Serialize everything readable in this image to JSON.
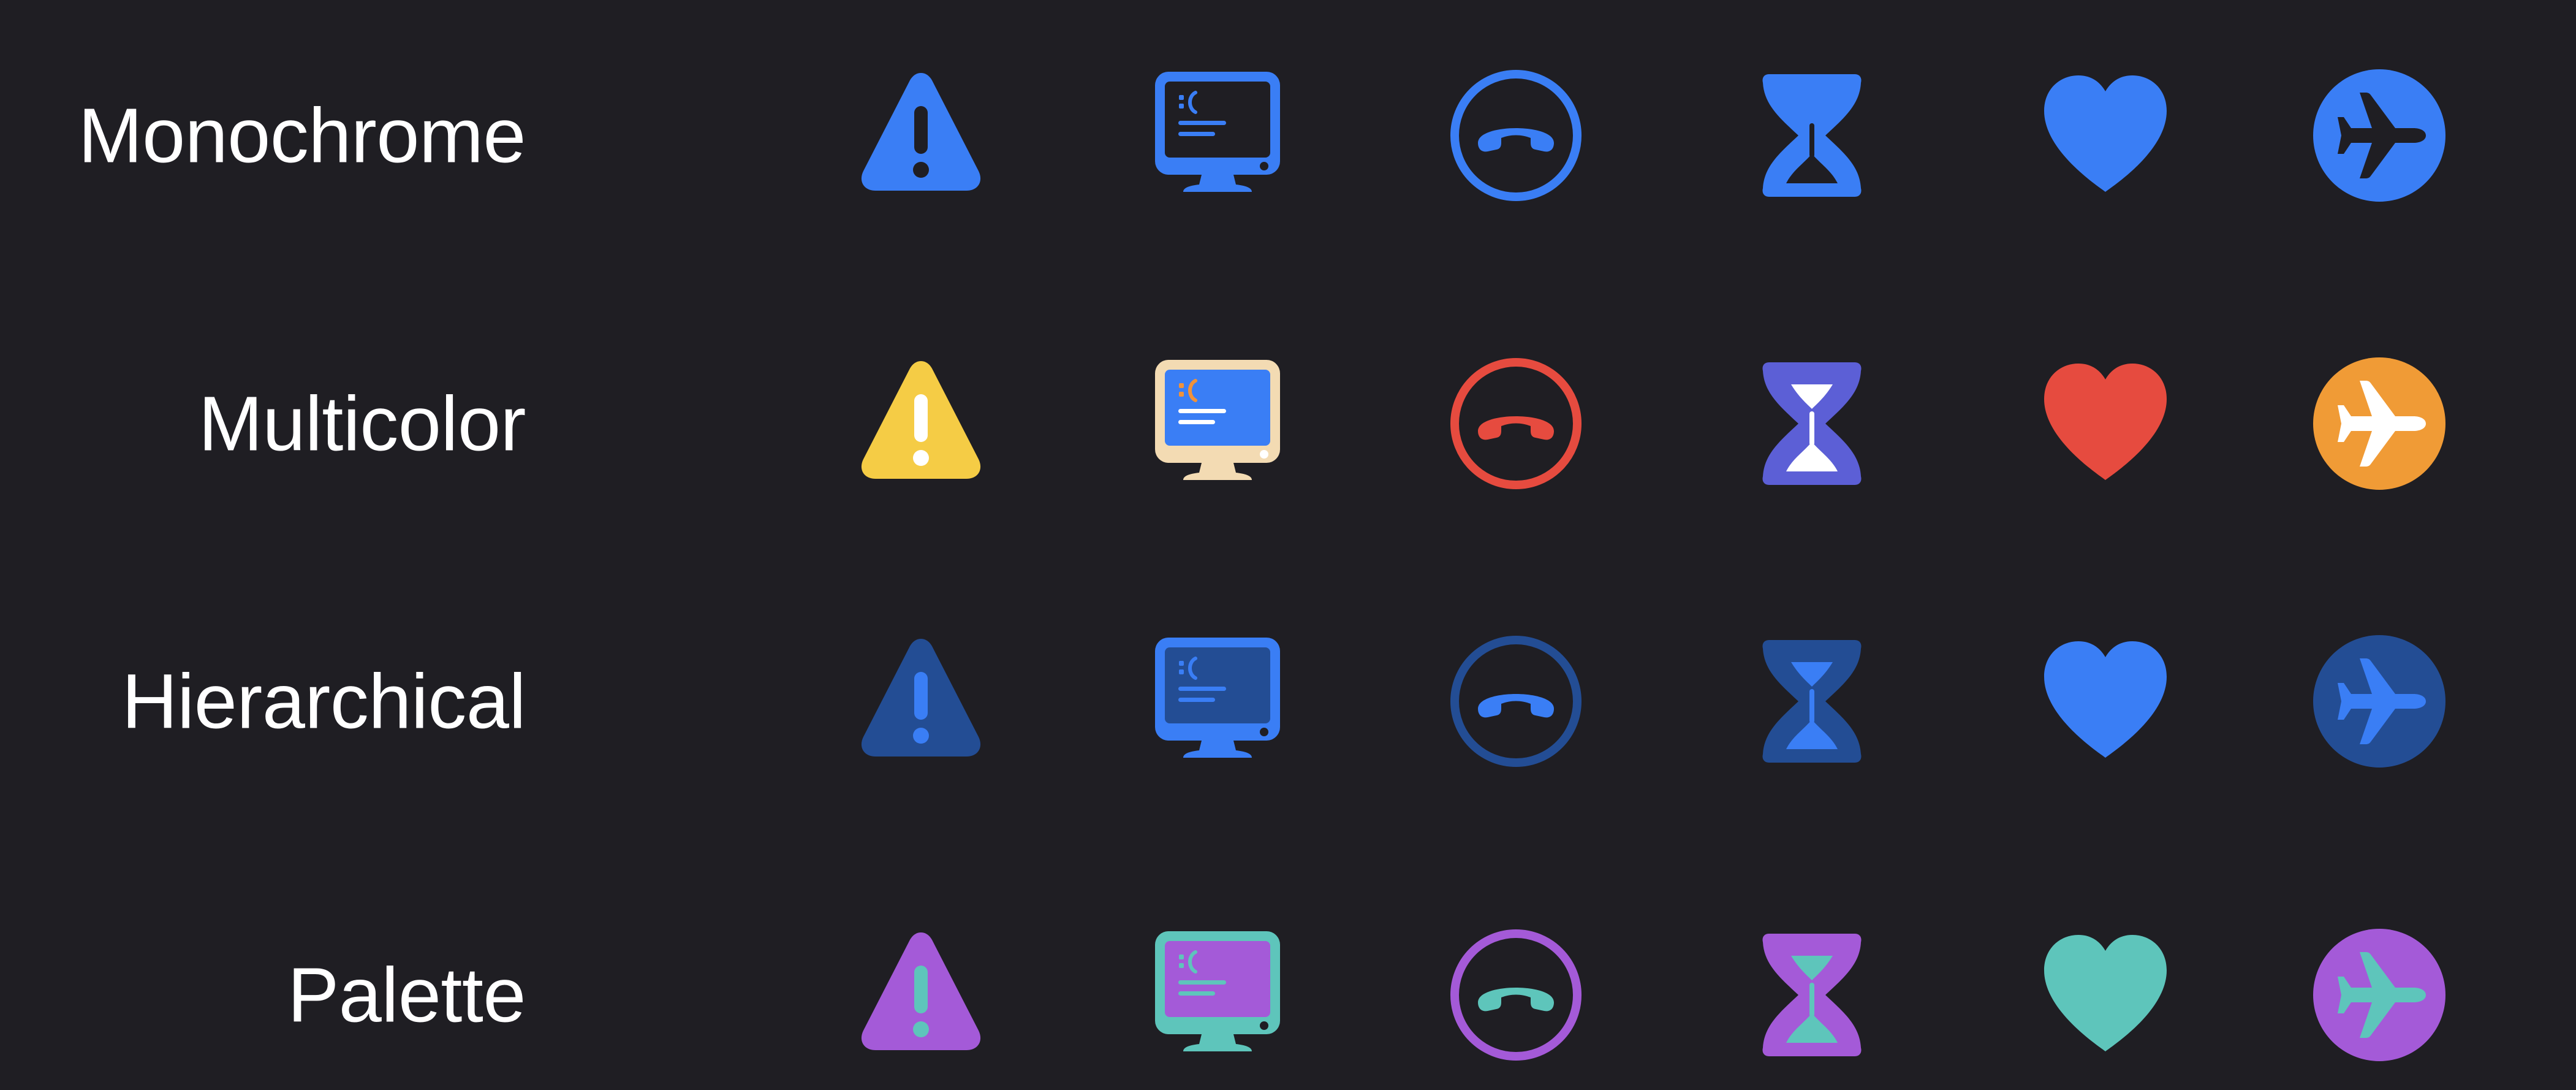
{
  "rows": [
    {
      "label": "Monochrome",
      "colors": {
        "warn_fill": "#3a7ef5",
        "warn_mark": "#1f1e23",
        "screen_body": "#3a7ef5",
        "screen_inner": "#1f1e23",
        "screen_face": "#3a7ef5",
        "screen_lines": "#3a7ef5",
        "screen_dot": "#1f1e23",
        "phone_ring": "#3a7ef5",
        "phone_handset": "#3a7ef5",
        "hourglass_frame": "#3a7ef5",
        "hourglass_sand": "#1f1e23",
        "hourglass_inner": "#3a7ef5",
        "heart": "#3a7ef5",
        "plane_circle": "#3a7ef5",
        "plane": "#1f1e23"
      }
    },
    {
      "label": "Multicolor",
      "colors": {
        "warn_fill": "#f5cc45",
        "warn_mark": "#ffffff",
        "screen_body": "#f3dbb3",
        "screen_inner": "#3a7ef5",
        "screen_face": "#f0923a",
        "screen_lines": "#ffffff",
        "screen_dot": "#ffffff",
        "phone_ring": "#e64b3f",
        "phone_handset": "#e64b3f",
        "hourglass_frame": "#5c5fd6",
        "hourglass_sand": "#ffffff",
        "hourglass_inner": "#ffffff",
        "heart": "#e64b3f",
        "plane_circle": "#f09b36",
        "plane": "#ffffff"
      }
    },
    {
      "label": "Hierarchical",
      "colors": {
        "warn_fill": "#234d94",
        "warn_mark": "#3a7ef5",
        "screen_body": "#3a7ef5",
        "screen_inner": "#234d94",
        "screen_face": "#3a7ef5",
        "screen_lines": "#3a7ef5",
        "screen_dot": "#1f1e23",
        "phone_ring": "#234d94",
        "phone_handset": "#3a7ef5",
        "hourglass_frame": "#234d94",
        "hourglass_sand": "#3a7ef5",
        "hourglass_inner": "#3a7ef5",
        "heart": "#3a7ef5",
        "plane_circle": "#234d94",
        "plane": "#3a7ef5"
      }
    },
    {
      "label": "Palette",
      "colors": {
        "warn_fill": "#a45ad8",
        "warn_mark": "#5ec5bb",
        "screen_body": "#5ec5bb",
        "screen_inner": "#a45ad8",
        "screen_face": "#5ec5bb",
        "screen_lines": "#5ec5bb",
        "screen_dot": "#1f1e23",
        "phone_ring": "#a45ad8",
        "phone_handset": "#5ec5bb",
        "hourglass_frame": "#a45ad8",
        "hourglass_sand": "#5ec5bb",
        "hourglass_inner": "#5ec5bb",
        "heart": "#5ec5bb",
        "plane_circle": "#a45ad8",
        "plane": "#5ec5bb"
      }
    }
  ],
  "icons": [
    "exclamationmark-triangle-icon",
    "desktop-computer-sad-icon",
    "phone-down-circle-icon",
    "hourglass-icon",
    "heart-icon",
    "airplane-circle-icon"
  ]
}
